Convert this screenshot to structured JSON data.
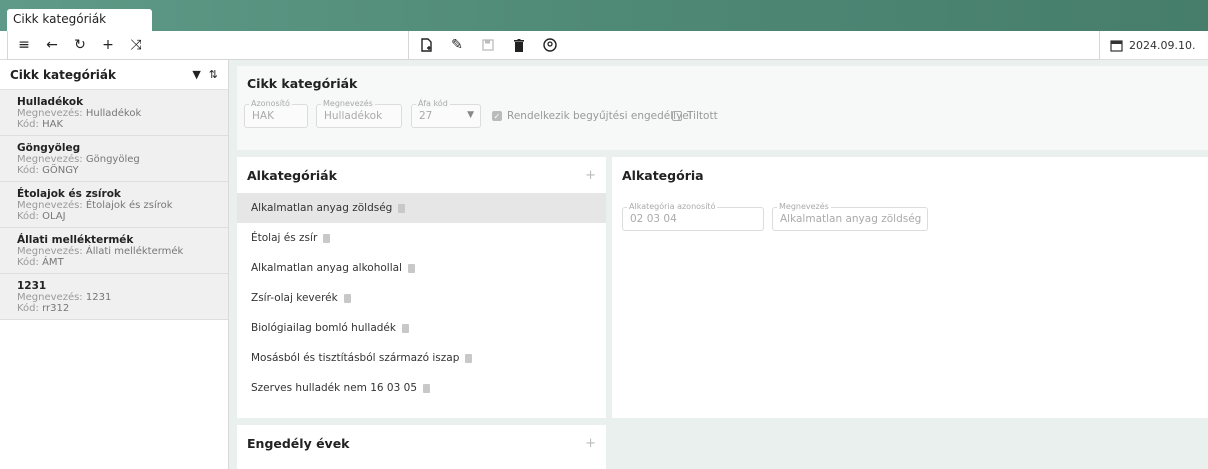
{
  "tab": {
    "title": "Cikk kategóriák"
  },
  "toolbar": {
    "date": "2024.09.10."
  },
  "sidebar": {
    "title": "Cikk kategóriák",
    "items": [
      {
        "title": "Hulladékok",
        "name_label": "Megnevezés:",
        "name": "Hulladékok",
        "code_label": "Kód:",
        "code": "HAK"
      },
      {
        "title": "Göngyöleg",
        "name_label": "Megnevezés:",
        "name": "Göngyöleg",
        "code_label": "Kód:",
        "code": "GÖNGY"
      },
      {
        "title": "Étolajok és zsírok",
        "name_label": "Megnevezés:",
        "name": "Étolajok és zsírok",
        "code_label": "Kód:",
        "code": "OLAJ"
      },
      {
        "title": "Állati melléktermék",
        "name_label": "Megnevezés:",
        "name": "Állati melléktermék",
        "code_label": "Kód:",
        "code": "ÁMT"
      },
      {
        "title": "1231",
        "name_label": "Megnevezés:",
        "name": "1231",
        "code_label": "Kód:",
        "code": "rr312"
      }
    ]
  },
  "category": {
    "title": "Cikk kategóriák",
    "id_label": "Azonosító",
    "id_value": "HAK",
    "name_label": "Megnevezés",
    "name_value": "Hulladékok",
    "vat_label": "Áfa kód",
    "vat_value": "27",
    "permit_label": "Rendelkezik begyűjtési engedéllyel",
    "banned_label": "Tiltott"
  },
  "subcategories": {
    "title": "Alkategóriák",
    "items": [
      "Alkalmatlan anyag zöldség",
      "Étolaj és zsír",
      "Alkalmatlan anyag alkohollal",
      "Zsír-olaj keverék",
      "Biológiailag bomló hulladék",
      "Mosásból és tisztításból származó iszap",
      "Szerves hulladék nem 16 03 05"
    ]
  },
  "subcategory": {
    "title": "Alkategória",
    "id_label": "Alkategória azonosító",
    "id_value": "02 03 04",
    "name_label": "Megnevezés",
    "name_value": "Alkalmatlan anyag zöldség"
  },
  "permits": {
    "title": "Engedély évek"
  }
}
